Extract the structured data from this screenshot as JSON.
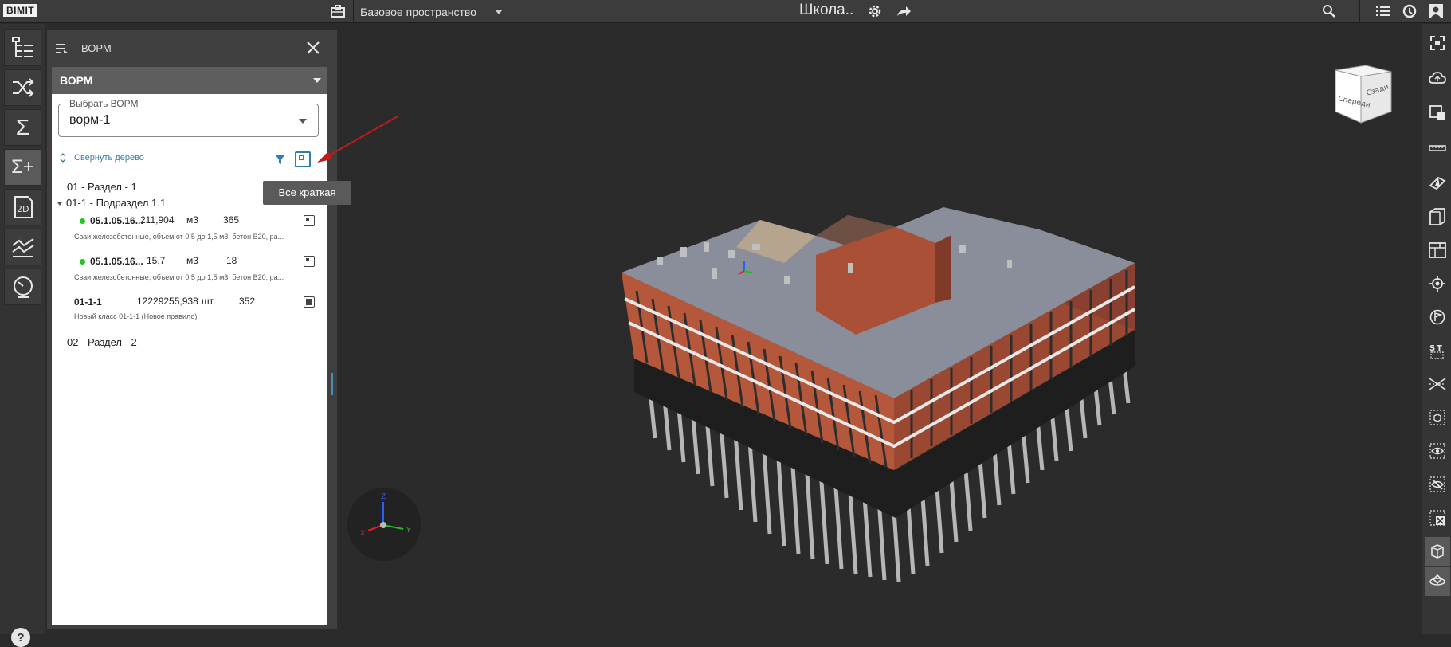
{
  "topbar": {
    "logo": "BIMIT",
    "space_label": "Базовое пространство",
    "project_title": "Школа.."
  },
  "panel": {
    "title": "ВОРМ",
    "section": "ВОРМ",
    "select_legend": "Выбрать ВОРМ",
    "select_value": "ворм-1",
    "collapse_label": "Свернуть дерево",
    "tooltip": "Все краткая"
  },
  "tree": {
    "section1": "01 - Раздел - 1",
    "subsection": "01-1 - Подраздел 1.1",
    "items": [
      {
        "code": "05.1.05.16...",
        "qty": "211,904",
        "unit": "м3",
        "count": "365",
        "desc": "Сваи железобетонные, объем от 0,5 до 1,5 м3, бетон В20, ра..."
      },
      {
        "code": "05.1.05.16...",
        "qty": "15,7",
        "unit": "м3",
        "count": "18",
        "desc": "Сваи железобетонные, объем от 0,5 до 1,5 м3, бетон В20, ра..."
      },
      {
        "code": "01-1-1",
        "qty": "12229255,938",
        "unit": "шт",
        "count": "352",
        "desc": "Новый класс 01-1-1 (Новое правило)"
      }
    ],
    "section2": "02 - Раздел - 2"
  },
  "left_toolbar": [
    {
      "icon": "tree-icon"
    },
    {
      "icon": "shuffle-icon"
    },
    {
      "icon": "sum-icon"
    },
    {
      "icon": "sum-plus-icon"
    },
    {
      "icon": "2d-icon"
    },
    {
      "icon": "chart-icon"
    },
    {
      "icon": "gauge-icon"
    }
  ],
  "viewcube": {
    "front": "Спереди",
    "right": "Сзади"
  },
  "axes": {
    "x": "X",
    "y": "Y",
    "z": "Z"
  },
  "colors": {
    "accent": "#2a7fb4",
    "brick": "#b5573a",
    "roof": "#8a8e9a",
    "green_dot": "#1ec81e"
  }
}
